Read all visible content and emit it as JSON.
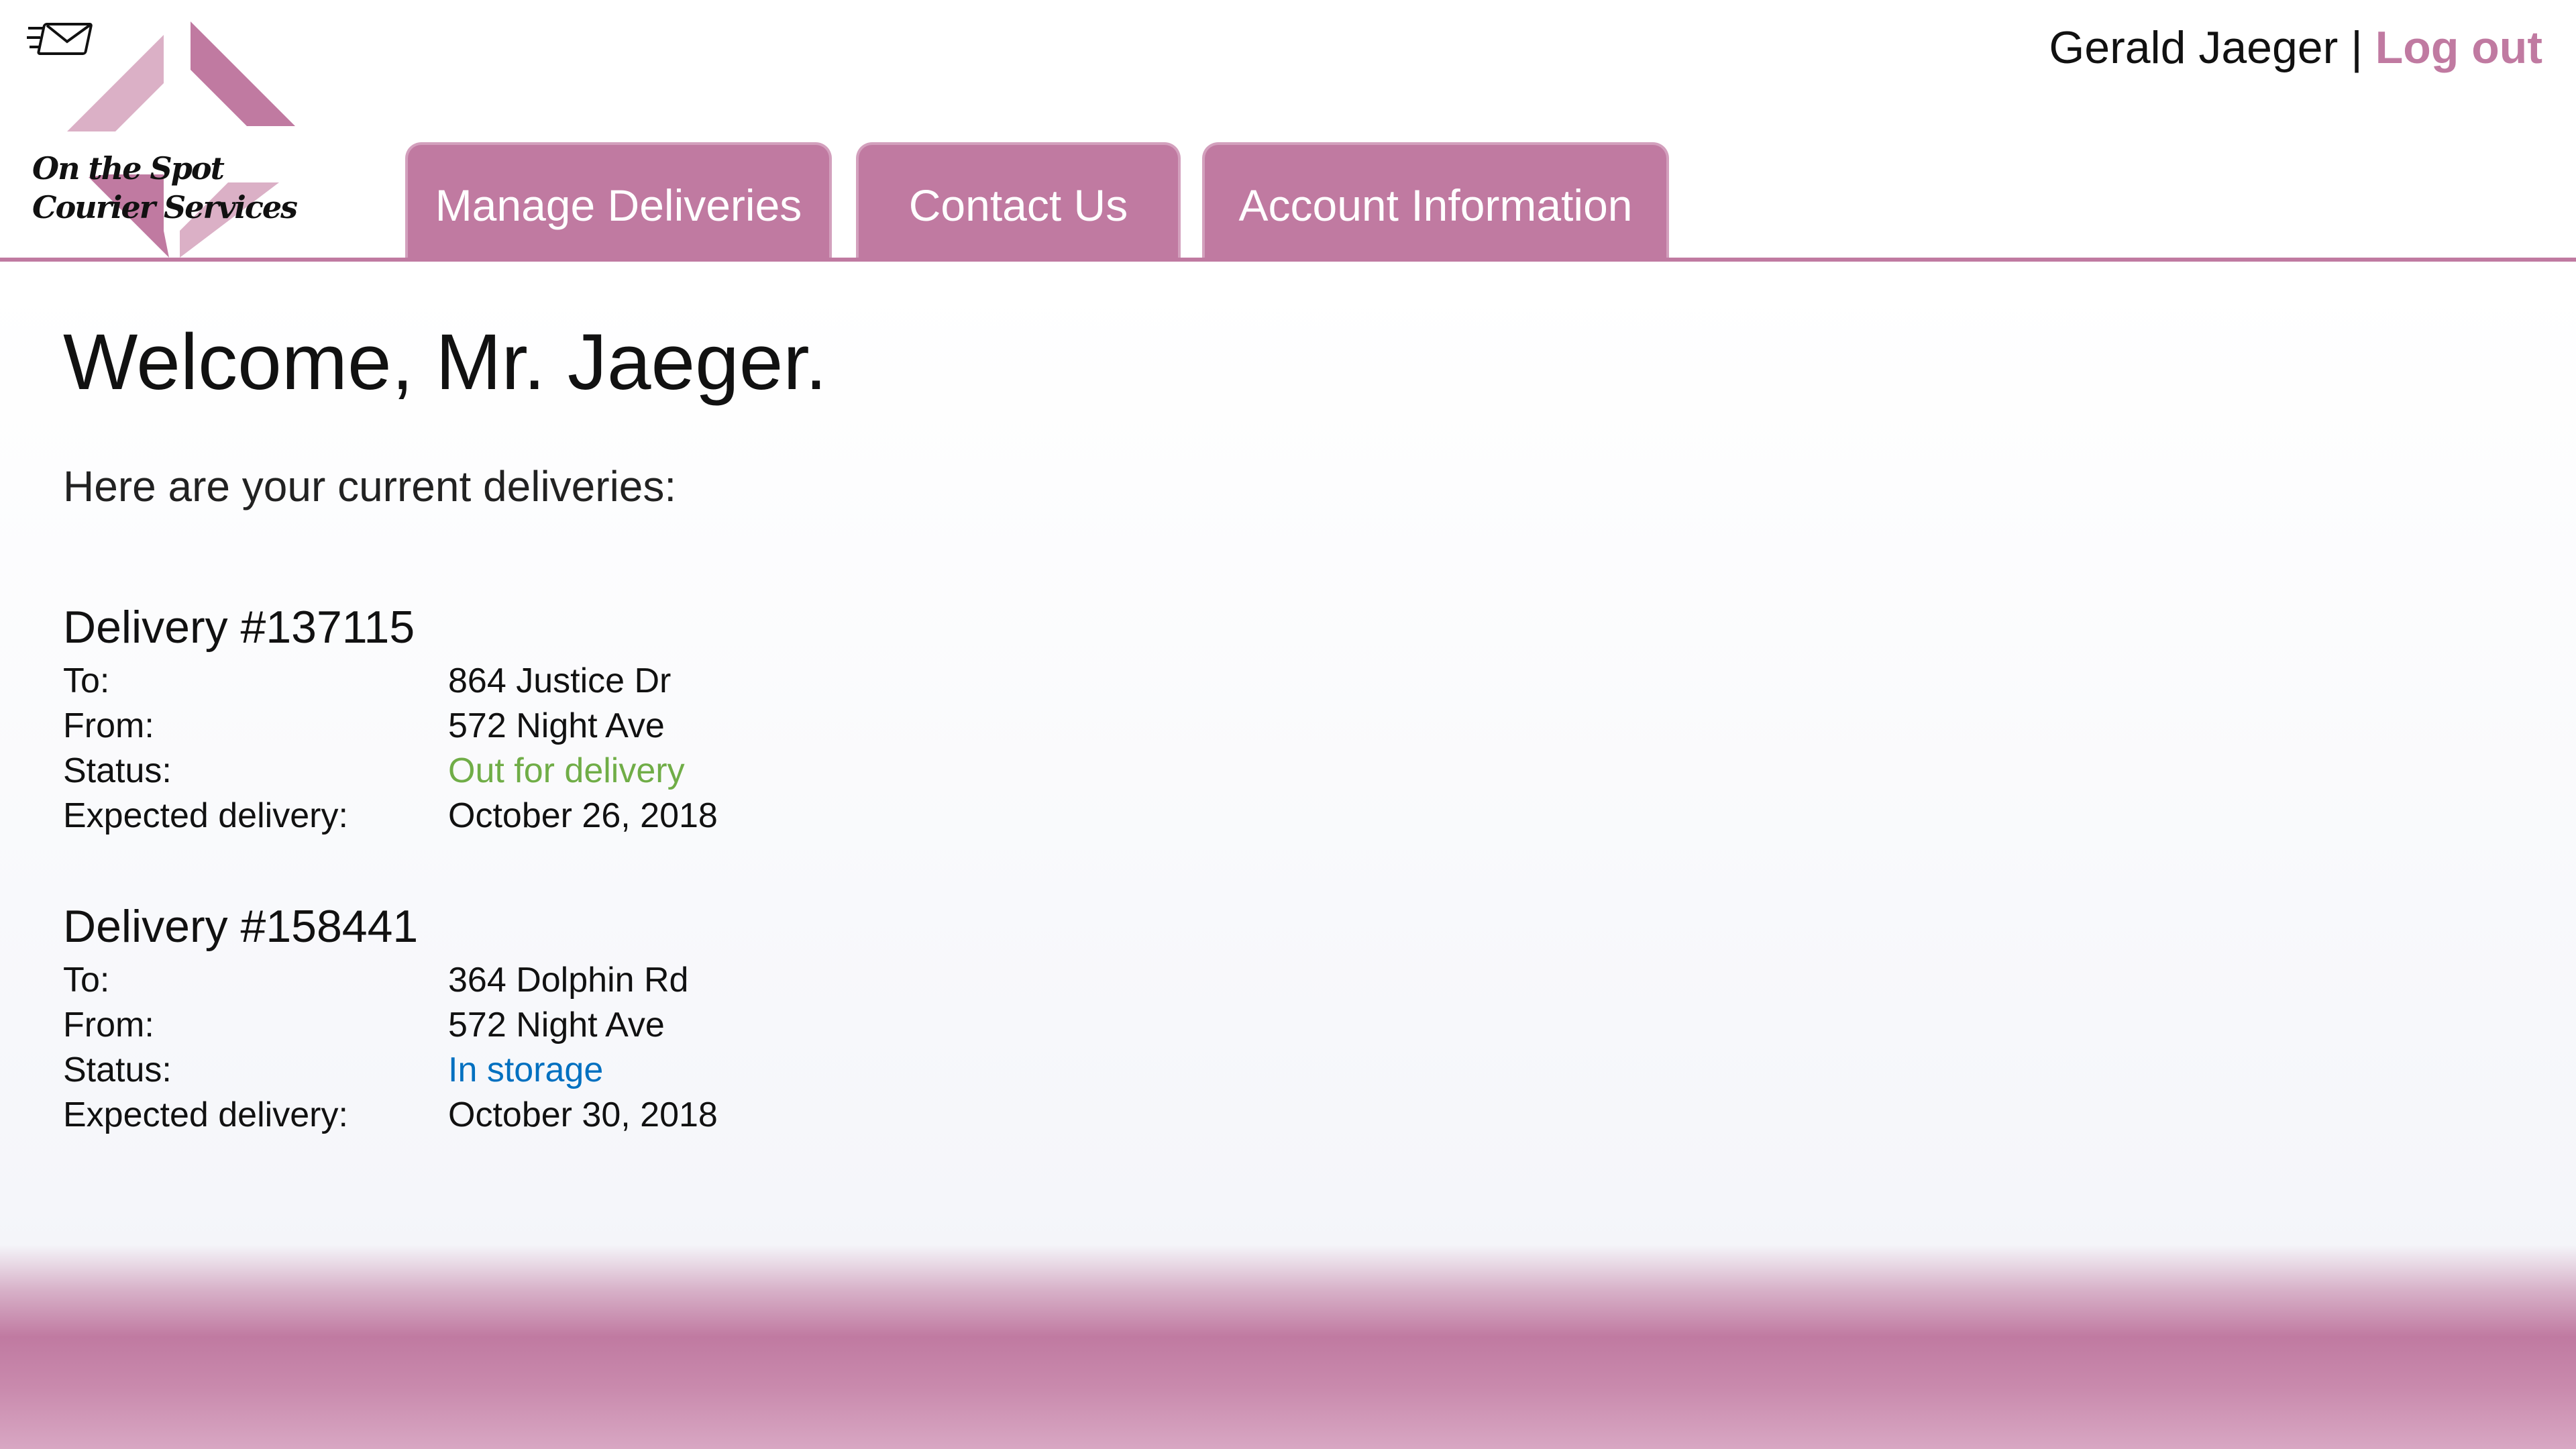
{
  "app": {
    "logo_line1": "On the Spot",
    "logo_line2": "Courier Services",
    "logo_icon": "envelope-icon",
    "brand_color": "#c07aa1"
  },
  "header": {
    "user_name": "Gerald Jaeger",
    "separator": "|",
    "logout_label": "Log out"
  },
  "nav": {
    "tabs": [
      {
        "label": "Manage Deliveries"
      },
      {
        "label": "Contact Us"
      },
      {
        "label": "Account Information"
      }
    ]
  },
  "main": {
    "welcome": "Welcome, Mr. Jaeger.",
    "intro": "Here are your current deliveries:",
    "labels": {
      "to": "To:",
      "from": "From:",
      "status": "Status:",
      "expected": "Expected delivery:"
    },
    "deliveries": [
      {
        "title": "Delivery #137115",
        "to": "864 Justice Dr",
        "from": "572 Night Ave",
        "status": "Out for delivery",
        "status_color": "#70ad47",
        "expected": "October 26, 2018"
      },
      {
        "title": "Delivery #158441",
        "to": "364 Dolphin Rd",
        "from": "572 Night Ave",
        "status": "In storage",
        "status_color": "#0070c0",
        "expected": "October 30, 2018"
      }
    ]
  }
}
